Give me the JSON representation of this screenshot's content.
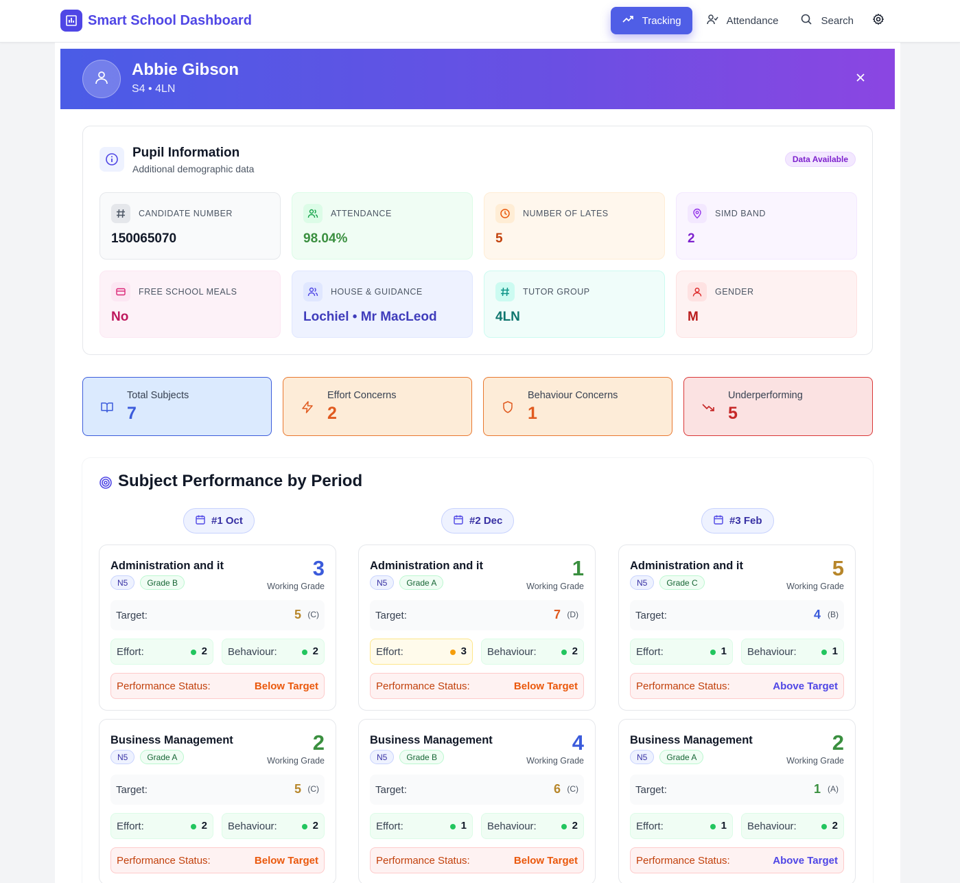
{
  "app": {
    "title": "Smart School Dashboard",
    "nav": [
      {
        "label": "Tracking",
        "icon": "trending-up-icon",
        "active": true
      },
      {
        "label": "Attendance",
        "icon": "user-check-icon",
        "active": false
      },
      {
        "label": "Search",
        "icon": "search-icon",
        "active": false
      }
    ],
    "settings_icon": "gear-icon"
  },
  "pupil": {
    "name": "Abbie Gibson",
    "subtitle": "S4 • 4LN"
  },
  "info": {
    "title": "Pupil Information",
    "subtitle": "Additional demographic data",
    "badge": "Data Available",
    "tiles": [
      {
        "label": "Candidate Number",
        "value": "150065070",
        "icon": "hash-icon"
      },
      {
        "label": "Attendance",
        "value": "98.04%",
        "icon": "users-icon"
      },
      {
        "label": "Number of Lates",
        "value": "5",
        "icon": "clock-icon"
      },
      {
        "label": "SIMD Band",
        "value": "2",
        "icon": "map-pin-icon"
      },
      {
        "label": "Free School Meals",
        "value": "No",
        "icon": "credit-card-icon"
      },
      {
        "label": "House & Guidance",
        "value": "Lochiel • Mr MacLeod",
        "icon": "users-icon"
      },
      {
        "label": "Tutor Group",
        "value": "4LN",
        "icon": "hash-icon"
      },
      {
        "label": "Gender",
        "value": "M",
        "icon": "user-icon"
      }
    ]
  },
  "summary": [
    {
      "label": "Total Subjects",
      "value": "7",
      "icon": "book-icon"
    },
    {
      "label": "Effort Concerns",
      "value": "2",
      "icon": "zap-icon"
    },
    {
      "label": "Behaviour Concerns",
      "value": "1",
      "icon": "shield-icon"
    },
    {
      "label": "Underperforming",
      "value": "5",
      "icon": "trending-down-icon"
    }
  ],
  "performance": {
    "title": "Subject Performance by Period",
    "periods": [
      "#1 Oct",
      "#2 Dec",
      "#3 Feb"
    ],
    "labels": {
      "working_grade": "Working Grade",
      "target": "Target:",
      "effort": "Effort:",
      "behaviour": "Behaviour:",
      "status": "Performance Status:"
    },
    "subjects": [
      {
        "name": "Administration and it",
        "periods": [
          {
            "level": "N5",
            "grade": "Grade B",
            "working": "3",
            "target": "5",
            "target_grade": "(C)",
            "effort": "2",
            "behaviour": "2",
            "status": "Below Target"
          },
          {
            "level": "N5",
            "grade": "Grade A",
            "working": "1",
            "target": "7",
            "target_grade": "(D)",
            "effort": "3",
            "behaviour": "2",
            "status": "Below Target"
          },
          {
            "level": "N5",
            "grade": "Grade C",
            "working": "5",
            "target": "4",
            "target_grade": "(B)",
            "effort": "1",
            "behaviour": "1",
            "status": "Above Target"
          }
        ]
      },
      {
        "name": "Business Management",
        "periods": [
          {
            "level": "N5",
            "grade": "Grade A",
            "working": "2",
            "target": "5",
            "target_grade": "(C)",
            "effort": "2",
            "behaviour": "2",
            "status": "Below Target"
          },
          {
            "level": "N5",
            "grade": "Grade B",
            "working": "4",
            "target": "6",
            "target_grade": "(C)",
            "effort": "1",
            "behaviour": "2",
            "status": "Below Target"
          },
          {
            "level": "N5",
            "grade": "Grade A",
            "working": "2",
            "target": "1",
            "target_grade": "(A)",
            "effort": "1",
            "behaviour": "2",
            "status": "Above Target"
          }
        ]
      }
    ]
  },
  "colors": {
    "accent": "#4f46e5",
    "green": "#3a8f3f",
    "amber": "#b7862a",
    "orange": "#e05a1f",
    "blue": "#3b5bdb",
    "red": "#c62828"
  }
}
